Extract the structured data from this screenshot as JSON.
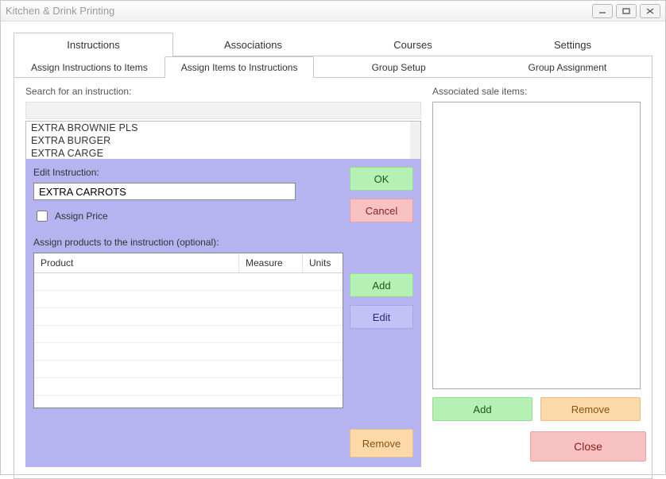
{
  "window": {
    "title": "Kitchen & Drink Printing"
  },
  "tabs": {
    "main": [
      "Instructions",
      "Associations",
      "Courses",
      "Settings"
    ],
    "sub": [
      "Assign Instructions to Items",
      "Assign Items to Instructions",
      "Group Setup",
      "Group Assignment"
    ]
  },
  "left": {
    "search_label": "Search for an instruction:",
    "list_items": [
      "EXTRA BROWNIE PLS",
      "EXTRA BURGER",
      "EXTRA CARGE"
    ]
  },
  "edit": {
    "title": "Edit Instruction:",
    "value": "EXTRA CARROTS",
    "assign_price_label": "Assign Price",
    "products_label": "Assign products to the instruction (optional):",
    "columns": [
      "Product",
      "Measure",
      "Units"
    ],
    "buttons": {
      "ok": "OK",
      "cancel": "Cancel",
      "add": "Add",
      "edit": "Edit",
      "remove": "Remove"
    }
  },
  "right": {
    "title": "Associated sale items:",
    "buttons": {
      "add": "Add",
      "remove": "Remove"
    }
  },
  "footer": {
    "close": "Close"
  },
  "colors": {
    "panel_purple": "#b5b3f0",
    "btn_green": "#b5f0b5",
    "btn_red": "#f8c2c2",
    "btn_purple": "#c3c1f5",
    "btn_orange": "#fcd9a8"
  }
}
